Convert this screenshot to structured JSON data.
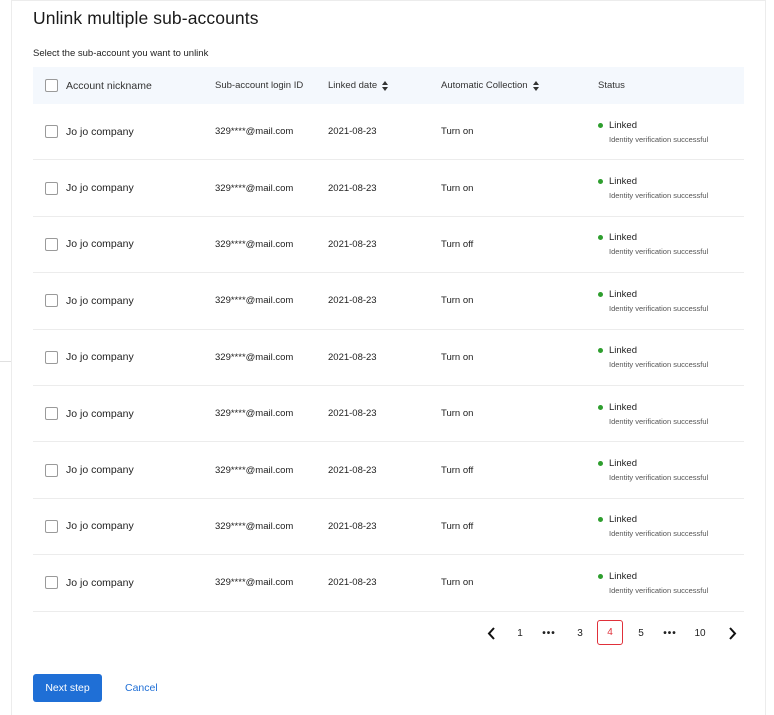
{
  "title": "Unlink multiple sub-accounts",
  "subtitle": "Select the sub-account you want to unlink",
  "table": {
    "headers": {
      "nickname": "Account nickname",
      "login_id": "Sub-account login ID",
      "linked_date": "Linked date",
      "auto_collection": "Automatic Collection",
      "status": "Status"
    },
    "rows": [
      {
        "nickname": "Jo jo company",
        "login_id": "329****@mail.com",
        "linked_date": "2021-08-23",
        "auto_collection": "Turn on",
        "status": "Linked",
        "status_detail": "Identity verification successful",
        "checked": false
      },
      {
        "nickname": "Jo jo company",
        "login_id": "329****@mail.com",
        "linked_date": "2021-08-23",
        "auto_collection": "Turn on",
        "status": "Linked",
        "status_detail": "Identity verification successful",
        "checked": false
      },
      {
        "nickname": "Jo jo company",
        "login_id": "329****@mail.com",
        "linked_date": "2021-08-23",
        "auto_collection": "Turn off",
        "status": "Linked",
        "status_detail": "Identity verification successful",
        "checked": false
      },
      {
        "nickname": "Jo jo company",
        "login_id": "329****@mail.com",
        "linked_date": "2021-08-23",
        "auto_collection": "Turn on",
        "status": "Linked",
        "status_detail": "Identity verification successful",
        "checked": false
      },
      {
        "nickname": "Jo jo company",
        "login_id": "329****@mail.com",
        "linked_date": "2021-08-23",
        "auto_collection": "Turn on",
        "status": "Linked",
        "status_detail": "Identity verification successful",
        "checked": false
      },
      {
        "nickname": "Jo jo company",
        "login_id": "329****@mail.com",
        "linked_date": "2021-08-23",
        "auto_collection": "Turn on",
        "status": "Linked",
        "status_detail": "Identity verification successful",
        "checked": false
      },
      {
        "nickname": "Jo jo company",
        "login_id": "329****@mail.com",
        "linked_date": "2021-08-23",
        "auto_collection": "Turn off",
        "status": "Linked",
        "status_detail": "Identity verification successful",
        "checked": false
      },
      {
        "nickname": "Jo jo company",
        "login_id": "329****@mail.com",
        "linked_date": "2021-08-23",
        "auto_collection": "Turn off",
        "status": "Linked",
        "status_detail": "Identity verification successful",
        "checked": false
      },
      {
        "nickname": "Jo jo company",
        "login_id": "329****@mail.com",
        "linked_date": "2021-08-23",
        "auto_collection": "Turn on",
        "status": "Linked",
        "status_detail": "Identity verification successful",
        "checked": false
      }
    ]
  },
  "pagination": {
    "prev_icon": "chevron-left-icon",
    "next_icon": "chevron-right-icon",
    "items": [
      "1",
      "•••",
      "3",
      "4",
      "5",
      "•••",
      "10"
    ],
    "current": "4"
  },
  "buttons": {
    "next": "Next step",
    "cancel": "Cancel"
  },
  "colors": {
    "primary": "#1f6fd6",
    "active_page": "#e0303a",
    "status_linked": "#2e9e2e",
    "header_bg": "#f4f8fd"
  }
}
